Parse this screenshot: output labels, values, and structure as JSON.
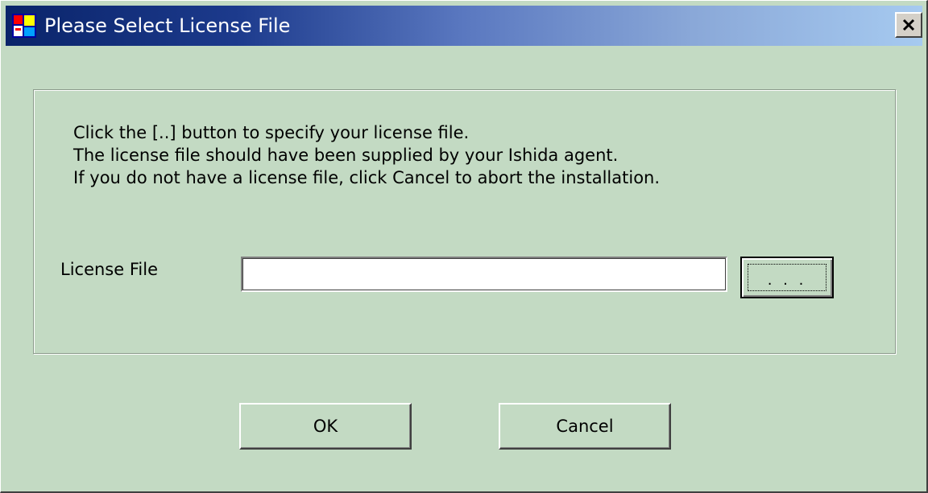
{
  "window": {
    "title": "Please Select License File",
    "close_icon": "close-icon",
    "app_icon": "application-icon"
  },
  "instructions": {
    "line1": "Click the [..] button to specify your license file.",
    "line2": "The license file should have been supplied by your Ishida agent.",
    "line3": "If you do not have a license file, click Cancel to abort the installation."
  },
  "license_field": {
    "label": "License File",
    "value": "",
    "browse_label": ". . ."
  },
  "buttons": {
    "ok_label": "OK",
    "cancel_label": "Cancel"
  },
  "colors": {
    "dialog_background": "#c3dac3",
    "titlebar_start": "#0a246a",
    "titlebar_end": "#a6caf0"
  }
}
